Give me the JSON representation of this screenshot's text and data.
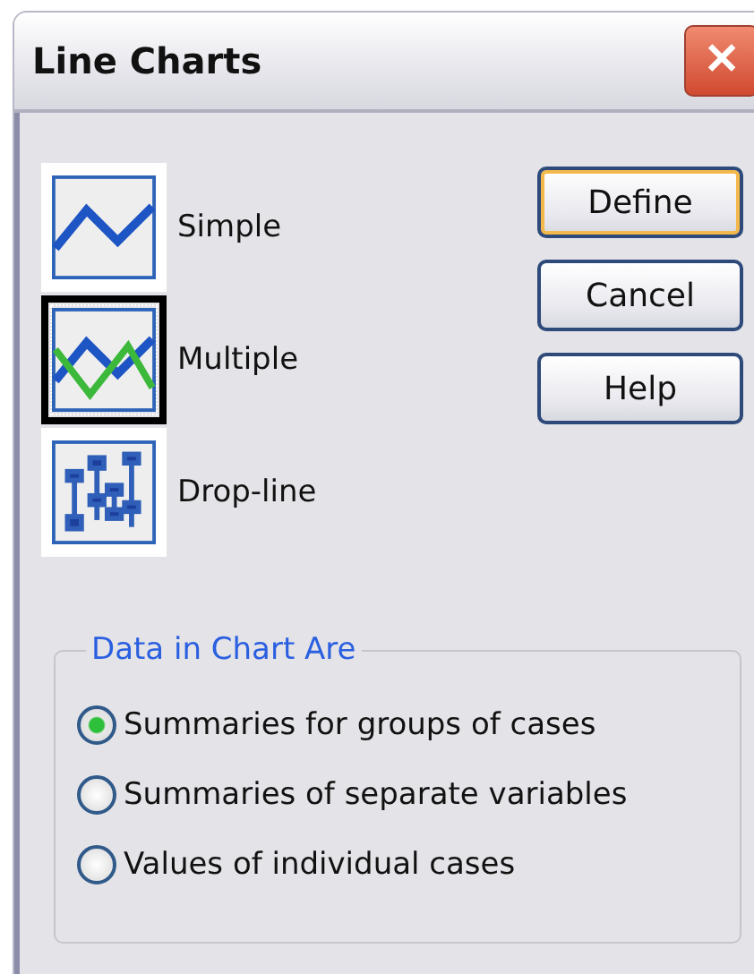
{
  "window": {
    "title": "Line Charts",
    "close": "✕"
  },
  "chart_types": [
    {
      "label": "Simple",
      "kind": "simple",
      "selected": false
    },
    {
      "label": "Multiple",
      "kind": "multiple",
      "selected": true
    },
    {
      "label": "Drop-line",
      "kind": "dropline",
      "selected": false
    }
  ],
  "buttons": [
    {
      "label": "Define",
      "default": true
    },
    {
      "label": "Cancel",
      "default": false
    },
    {
      "label": "Help",
      "default": false
    }
  ],
  "group": {
    "title": "Data in Chart Are",
    "options": [
      {
        "label": "Summaries for groups of cases",
        "selected": true
      },
      {
        "label": "Summaries of separate variables",
        "selected": false
      },
      {
        "label": "Values of individual cases",
        "selected": false
      }
    ]
  }
}
